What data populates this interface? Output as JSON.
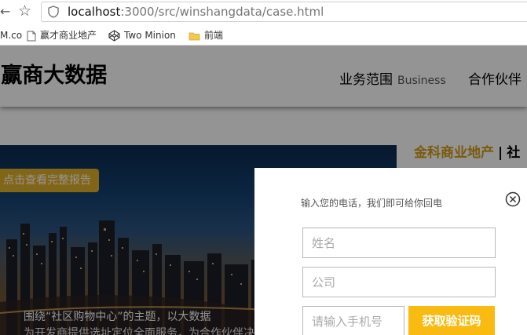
{
  "browser": {
    "back_glyph": "←",
    "star_glyph": "☆",
    "url_host": "localhost",
    "url_rest": ":3000/src/winshangdata/case.html",
    "bookmarks": [
      {
        "label": "M.co",
        "icon": "page-icon"
      },
      {
        "label": "赢才商业地产",
        "icon": "page-icon"
      },
      {
        "label": "Two Minion",
        "icon": "codepen-icon"
      },
      {
        "label": "前端",
        "icon": "folder-icon"
      }
    ]
  },
  "header": {
    "logo": "l赢商大数据",
    "nav": [
      {
        "label": "业务范围",
        "en": "Business"
      },
      {
        "label": "合作伙伴",
        "en": ""
      }
    ]
  },
  "hero": {
    "report_button": "点击查看完整报告",
    "caption_line1": "围绕“社区购物中心”的主题，以大数据",
    "caption_line2": "为开发商提供选址定位全面服务，为合作伙伴决"
  },
  "case_title": {
    "company": "金科商业地产",
    "separator": "|",
    "rest": "社"
  },
  "modal": {
    "prompt": "输入您的电话，我们即可给你回电",
    "name_placeholder": "姓名",
    "company_placeholder": "公司",
    "phone_placeholder": "请输入手机号",
    "code_button": "获取验证码"
  },
  "colors": {
    "accent_gold": "#f9bb12",
    "title_gold": "#d49b12",
    "report_button": "#e0b02a"
  }
}
